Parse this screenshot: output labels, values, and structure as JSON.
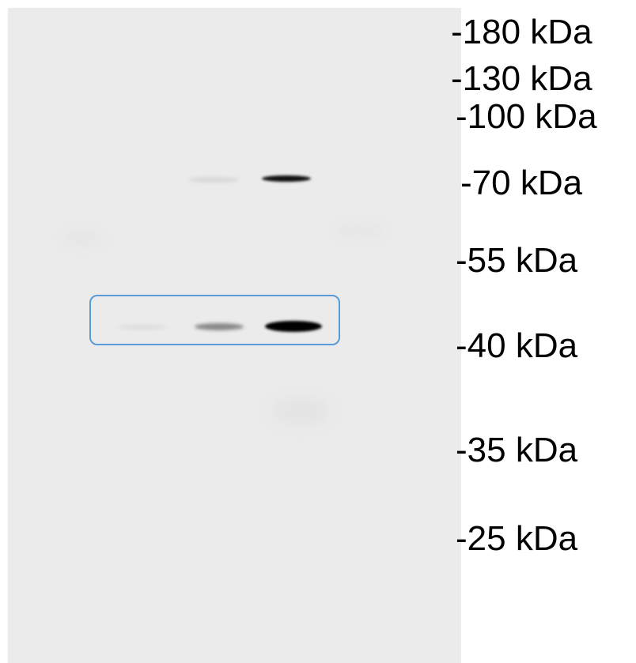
{
  "blot": {
    "markers": [
      {
        "label": "-180 kDa"
      },
      {
        "label": "-130 kDa"
      },
      {
        "label": "-100 kDa"
      },
      {
        "label": "-70 kDa"
      },
      {
        "label": "-55 kDa"
      },
      {
        "label": "-40 kDa"
      },
      {
        "label": "-35 kDa"
      },
      {
        "label": "-25 kDa"
      }
    ],
    "colors": {
      "membrane": "#ebebeb",
      "band": "#000000",
      "highlight_box": "#5b9bd5"
    }
  }
}
